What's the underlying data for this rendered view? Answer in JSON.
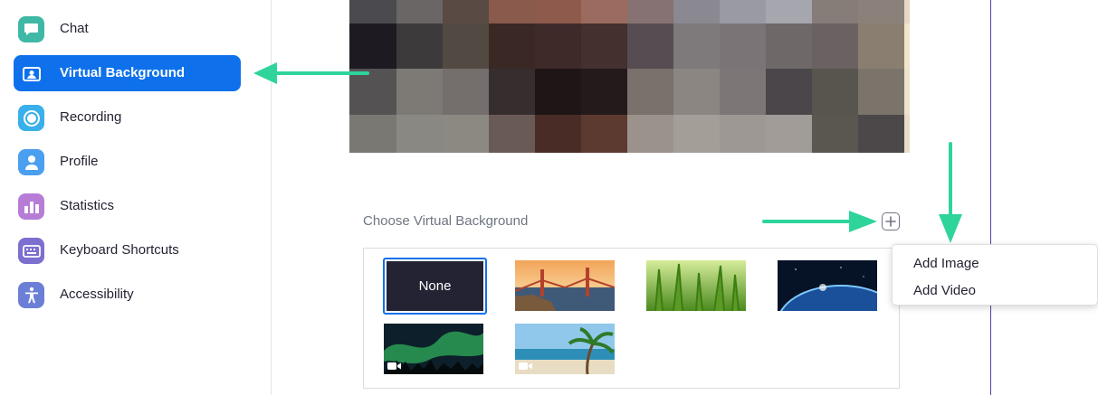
{
  "sidebar": {
    "items": [
      {
        "label": "Chat",
        "icon": "chat-icon",
        "color": "#3fb8a6"
      },
      {
        "label": "Virtual Background",
        "icon": "virtual-background-icon",
        "color": "#0e71eb",
        "active": true
      },
      {
        "label": "Recording",
        "icon": "recording-icon",
        "color": "#39b0ea"
      },
      {
        "label": "Profile",
        "icon": "profile-icon",
        "color": "#4a9ff0"
      },
      {
        "label": "Statistics",
        "icon": "statistics-icon",
        "color": "#b77dd6"
      },
      {
        "label": "Keyboard Shortcuts",
        "icon": "keyboard-icon",
        "color": "#7b6fcf"
      },
      {
        "label": "Accessibility",
        "icon": "accessibility-icon",
        "color": "#6b7fd6"
      }
    ]
  },
  "main": {
    "choose_label": "Choose Virtual Background",
    "add_button_icon": "plus-icon",
    "backgrounds": [
      {
        "label": "None",
        "selected": true
      },
      {
        "icon": "golden-gate-image"
      },
      {
        "icon": "grass-image"
      },
      {
        "icon": "earth-space-image"
      },
      {
        "icon": "aurora-video",
        "video": true
      },
      {
        "icon": "beach-palm-video",
        "video": true
      }
    ]
  },
  "menu": {
    "add_image": "Add Image",
    "add_video": "Add Video"
  },
  "colors": {
    "accent": "#0e71eb",
    "annotation_arrow": "#2ed49a"
  }
}
